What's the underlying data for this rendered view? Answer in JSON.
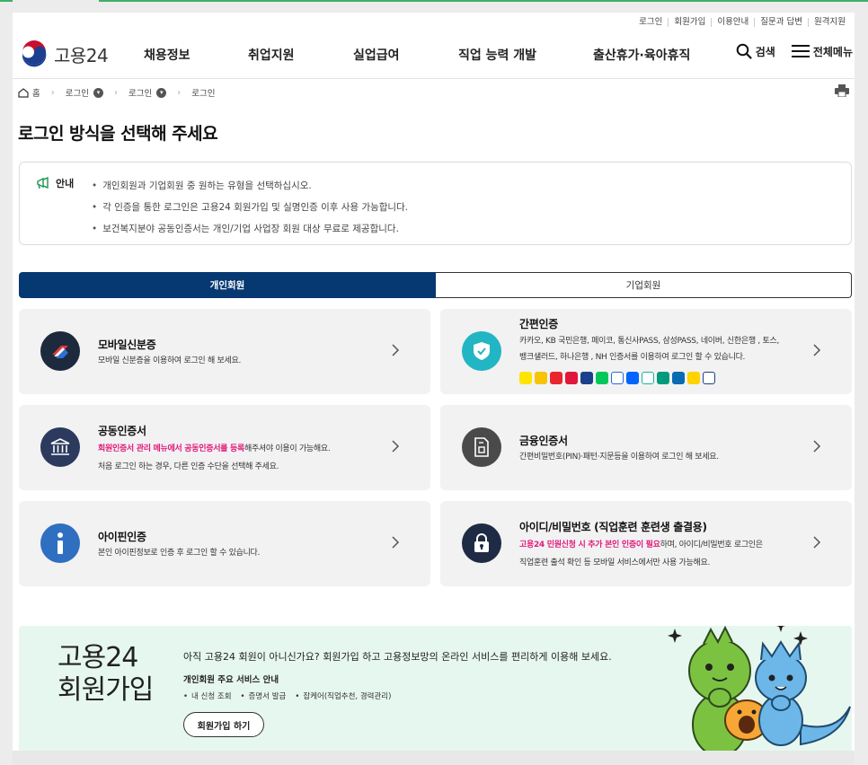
{
  "utility": [
    "로그인",
    "회원가입",
    "이용안내",
    "질문과 답변",
    "원격지원"
  ],
  "brand": {
    "name": "고용24"
  },
  "gnb": {
    "menu": [
      "채용정보",
      "취업지원",
      "실업급여",
      "직업 능력 개발",
      "출산휴가·육아휴직"
    ],
    "search_label": "검색",
    "all_menu_label": "전체메뉴"
  },
  "breadcrumb": [
    "홈",
    "로그인",
    "로그인",
    "로그인"
  ],
  "page_title": "로그인 방식을 선택해 주세요",
  "notice": {
    "label": "안내",
    "items": [
      "개인회원과 기업회원 중 원하는 유형을 선택하십시오.",
      "각 인증을 통한 로그인은 고용24 회원가입 및 실명인증 이후 사용 가능합니다.",
      "보건복지분야 공동인증서는 개인/기업 사업장 회원 대상 무료로 제공합니다."
    ]
  },
  "tabs": {
    "personal": "개인회원",
    "company": "기업회원"
  },
  "cards": {
    "mobile_id": {
      "title": "모바일신분증",
      "desc": "모바일 신분증을 이용하여 로그인 해 보세요."
    },
    "simple_auth": {
      "title": "간편인증",
      "desc1": "카카오, KB 국민은행, 페이코, 통신사PASS, 삼성PASS, 네이버, 신한은행 , 토스,",
      "desc2": "뱅크샐러드, 하나은행 , NH 인증서를 이용하여 로그인 할 수 있습니다."
    },
    "joint_cert": {
      "title": "공동인증서",
      "desc1_hl1": "회원인증서 관리 메뉴에서 공동인증서를 등록",
      "desc1_rest": "해주셔야 이용이 가능해요.",
      "desc2": "처음 로그인 하는 경우, 다른 인증 수단을 선택해 주세요."
    },
    "financial_cert": {
      "title": "금융인증서",
      "desc": "간편비밀번호(PIN)·패턴·지문등을 이용하여 로그인 해 보세요."
    },
    "ipin": {
      "title": "아이핀인증",
      "desc": "본인 아이핀정보로 인증 후 로그인 할 수 있습니다."
    },
    "id_pw": {
      "title": "아이디/비밀번호 (직업훈련 훈련생 출결용)",
      "desc1_hl": "고용24 민원신청 시 추가 본인 인증이 필요",
      "desc1_rest": "하며, 아이디/비밀번호 로그인은",
      "desc2": "직업훈련 출석 확인 등 모바일 서비스에서만 사용 가능해요."
    }
  },
  "join": {
    "title_line1": "고용24",
    "title_line2": "회원가입",
    "lead": "아직 고용24 회원이 아니신가요? 회원가입 하고 고용정보망의 온라인 서비스를 편리하게 이용해 보세요.",
    "sub": "개인회원 주요 서비스 안내",
    "services": [
      "내 신청 조회",
      "증명서 발급",
      "잡케어(직업추천, 경력관리)"
    ],
    "button": "회원가입 하기"
  },
  "colors": {
    "primary": "#063871",
    "highlight": "#e2197b",
    "banner": "#e6f7ef"
  }
}
